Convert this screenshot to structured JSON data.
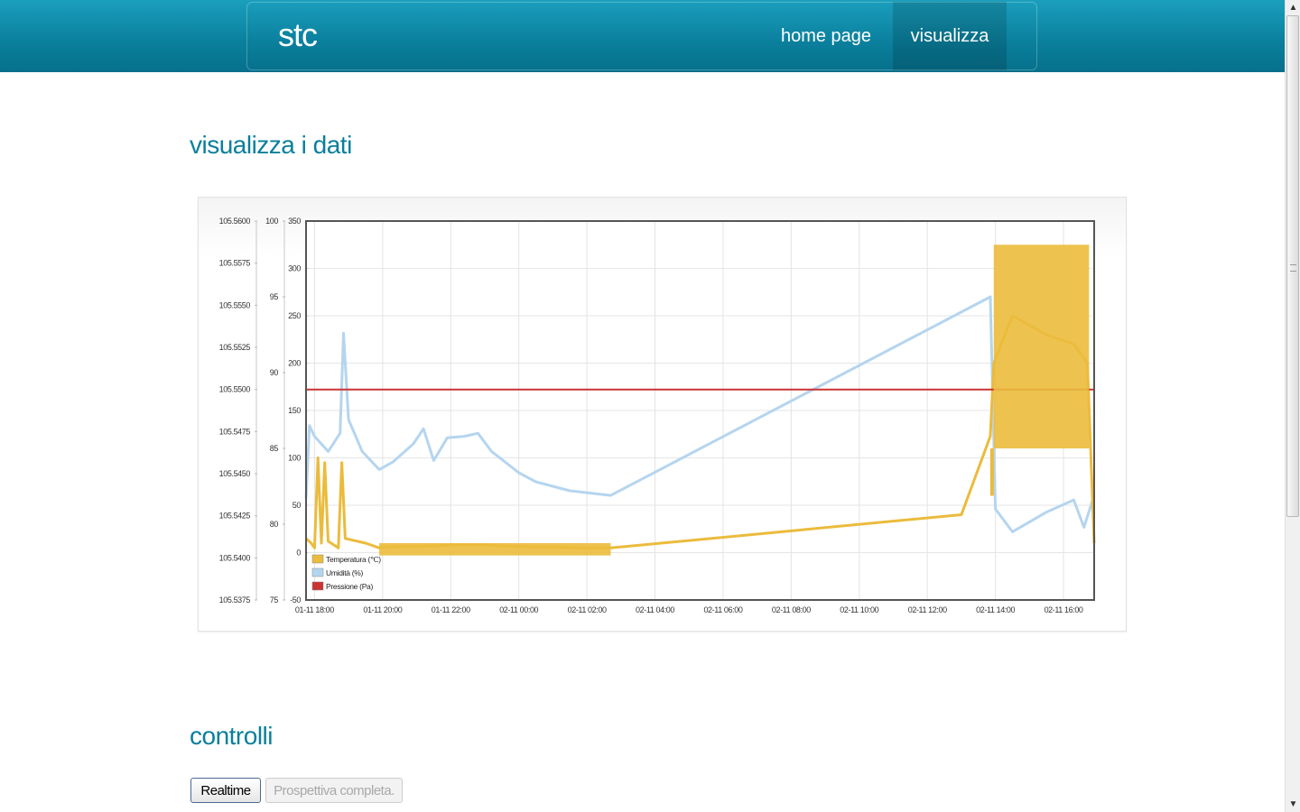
{
  "header": {
    "brand": "stc",
    "nav": [
      {
        "label": "home page",
        "active": false
      },
      {
        "label": "visualizza",
        "active": true
      }
    ]
  },
  "main": {
    "title": "visualizza i dati",
    "controls_title": "controlli",
    "buttons": [
      {
        "label": "Realtime",
        "enabled": true
      },
      {
        "label": "Prospettiva completa.",
        "enabled": false
      }
    ]
  },
  "colors": {
    "accent": "#0a7f9c",
    "temperature": "#ebbb3c",
    "humidity": "#b5d5ef",
    "pressure": "#cc3333"
  },
  "chart_data": {
    "type": "line",
    "x_tick_labels": [
      "01-11 18:00",
      "01-11 20:00",
      "01-11 22:00",
      "02-11 00:00",
      "02-11 02:00",
      "02-11 04:00",
      "02-11 06:00",
      "02-11 08:00",
      "02-11 10:00",
      "02-11 12:00",
      "02-11 14:00",
      "02-11 16:00"
    ],
    "x_start_hours": 17.75,
    "x_end_hours": 40.9,
    "axes": [
      {
        "id": "pressure_axis",
        "ticks": [
          "105.5600",
          "105.5575",
          "105.5550",
          "105.5525",
          "105.5500",
          "105.5475",
          "105.5450",
          "105.5425",
          "105.5400",
          "105.5375"
        ],
        "ylim": [
          105.5375,
          105.56
        ]
      },
      {
        "id": "humidity_axis",
        "ticks": [
          "100",
          "95",
          "90",
          "85",
          "80",
          "75"
        ],
        "ylim": [
          75,
          100
        ]
      },
      {
        "id": "temperature_axis",
        "ticks": [
          "350",
          "300",
          "250",
          "200",
          "150",
          "100",
          "50",
          "0",
          "-50"
        ],
        "ylim": [
          -50,
          350
        ]
      }
    ],
    "legend_position": "bottom-left",
    "grid": true,
    "series": [
      {
        "name": "Temperatura (℃)",
        "axis": "temperature_axis",
        "points": [
          [
            17.75,
            15
          ],
          [
            17.9,
            10
          ],
          [
            18.0,
            5
          ],
          [
            18.1,
            100
          ],
          [
            18.2,
            10
          ],
          [
            18.3,
            95
          ],
          [
            18.4,
            12
          ],
          [
            18.7,
            5
          ],
          [
            18.8,
            95
          ],
          [
            18.9,
            15
          ],
          [
            19.5,
            10
          ],
          [
            19.9,
            5
          ],
          [
            20.0,
            6
          ],
          [
            21.5,
            7
          ],
          [
            22.0,
            8
          ],
          [
            23.0,
            8
          ],
          [
            23.5,
            7
          ],
          [
            24.5,
            6
          ],
          [
            25.0,
            6
          ],
          [
            26.0,
            5
          ],
          [
            26.7,
            5
          ],
          [
            37.0,
            40
          ],
          [
            37.85,
            123
          ],
          [
            37.95,
            200
          ],
          [
            38.5,
            250
          ],
          [
            39.5,
            230
          ],
          [
            40.3,
            220
          ],
          [
            40.7,
            200
          ],
          [
            40.9,
            10
          ]
        ]
      },
      {
        "name": "Umidità (%)",
        "axis": "humidity_axis",
        "points": [
          [
            17.75,
            81.7
          ],
          [
            17.85,
            86.5
          ],
          [
            18.0,
            85.8
          ],
          [
            18.4,
            84.8
          ],
          [
            18.75,
            86.0
          ],
          [
            18.85,
            92.6
          ],
          [
            19.0,
            86.9
          ],
          [
            19.4,
            84.8
          ],
          [
            19.9,
            83.6
          ],
          [
            20.3,
            84.1
          ],
          [
            20.9,
            85.3
          ],
          [
            21.2,
            86.3
          ],
          [
            21.5,
            84.2
          ],
          [
            21.9,
            85.7
          ],
          [
            22.4,
            85.8
          ],
          [
            22.8,
            86.0
          ],
          [
            23.2,
            84.8
          ],
          [
            24.0,
            83.4
          ],
          [
            24.5,
            82.8
          ],
          [
            25.5,
            82.2
          ],
          [
            26.7,
            81.9
          ],
          [
            37.85,
            95.0
          ],
          [
            38.0,
            81.0
          ],
          [
            38.5,
            79.5
          ],
          [
            39.5,
            80.8
          ],
          [
            40.3,
            81.6
          ],
          [
            40.6,
            79.8
          ],
          [
            40.9,
            81.9
          ]
        ]
      },
      {
        "name": "Pressione (Pa)",
        "axis": "pressure_axis",
        "points": [
          [
            17.75,
            105.55
          ],
          [
            40.9,
            105.55
          ]
        ]
      }
    ]
  }
}
